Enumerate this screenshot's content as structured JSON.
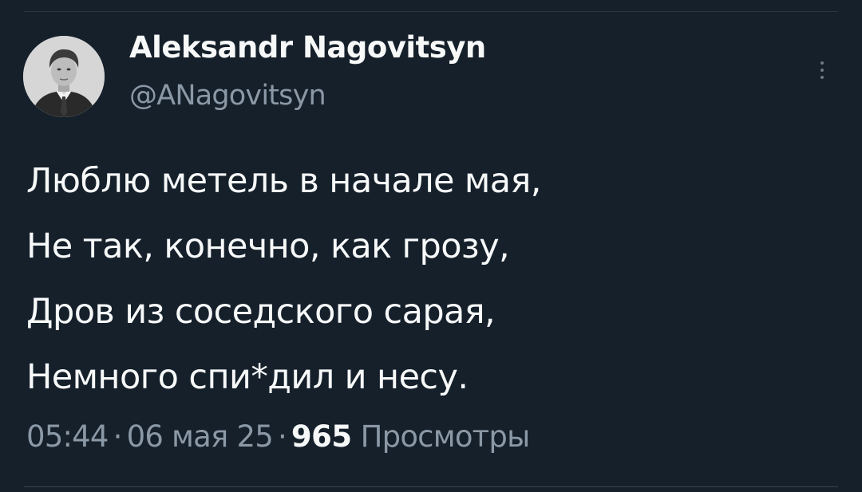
{
  "author": {
    "display_name": "Aleksandr Nagovitsyn",
    "handle": "@ANagovitsyn"
  },
  "tweet": {
    "lines": [
      "Люблю метель в начале мая,",
      "Не так, конечно, как грозу,",
      "Дров из соседского сарая,",
      "Немного спи*дил и несу."
    ]
  },
  "meta": {
    "time": "05:44",
    "separator": "·",
    "date": "06 мая 25",
    "views_count": "965",
    "views_label": "Просмотры"
  },
  "icons": {
    "more": "more-vertical-icon"
  },
  "colors": {
    "background": "#15202b",
    "text_primary": "#f7f9f9",
    "text_secondary": "#8b98a5",
    "divider": "#38444d"
  }
}
